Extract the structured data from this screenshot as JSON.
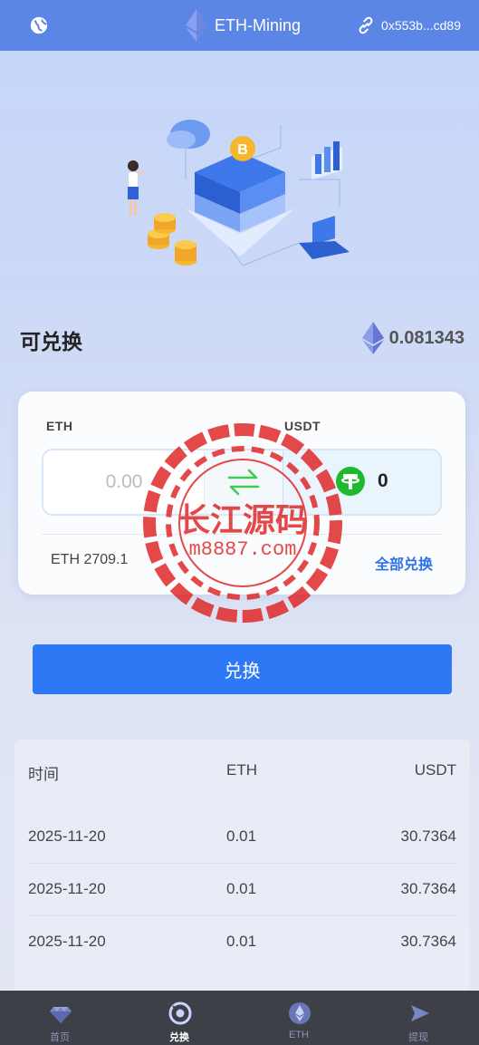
{
  "header": {
    "title": "ETH-Mining",
    "wallet_address": "0x553b...cd89",
    "globe_icon": "globe-icon",
    "link_icon": "link-icon"
  },
  "available": {
    "label": "可兑换",
    "amount": "0.081343",
    "coin_icon": "ethereum-icon"
  },
  "exchange": {
    "from_label": "ETH",
    "to_label": "USDT",
    "from_placeholder": "0.00",
    "to_value": "0",
    "price_text": "ETH 2709.1",
    "all_label": "全部兑换",
    "swap_color": "#27c13a",
    "tether_color": "#1db92e"
  },
  "submit": {
    "label": "兑换",
    "color": "#2f78f5"
  },
  "history": {
    "columns": [
      "时间",
      "ETH",
      "USDT"
    ],
    "rows": [
      {
        "time": "2025-11-20",
        "eth": "0.01",
        "usdt": "30.7364"
      },
      {
        "time": "2025-11-20",
        "eth": "0.01",
        "usdt": "30.7364"
      },
      {
        "time": "2025-11-20",
        "eth": "0.01",
        "usdt": "30.7364"
      }
    ]
  },
  "watermark": {
    "title": "长江源码",
    "url": "m8887.com",
    "color": "#e02a2a"
  },
  "tabs": [
    {
      "label": "首页",
      "icon": "diamond-icon",
      "active": false
    },
    {
      "label": "兑换",
      "icon": "exchange-icon",
      "active": true
    },
    {
      "label": "ETH",
      "icon": "ethereum-icon",
      "active": false
    },
    {
      "label": "提现",
      "icon": "send-icon",
      "active": false
    }
  ]
}
